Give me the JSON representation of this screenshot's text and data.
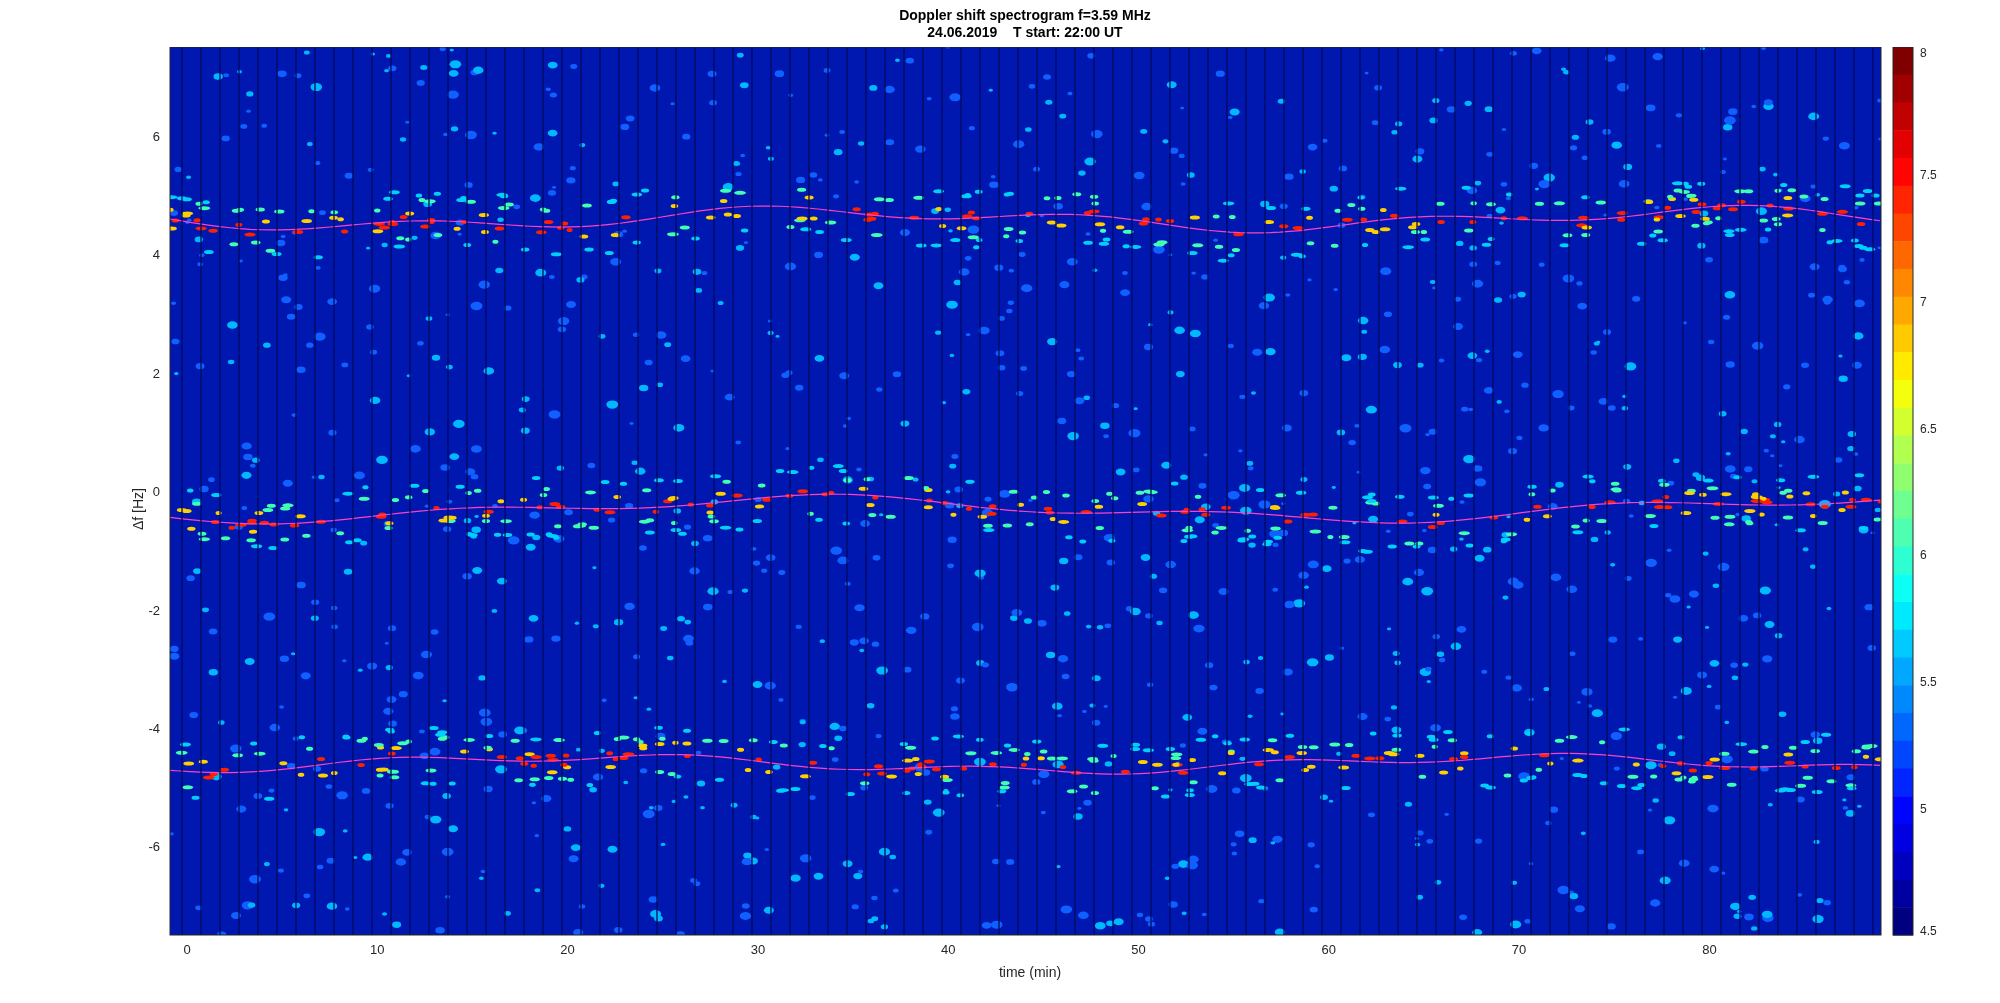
{
  "title": {
    "lines": [
      "Doppler shift spectrogram f=3.59 MHz",
      "24.06.2019    T start: 22:00 UT"
    ]
  },
  "plot": {
    "xlabel": "time (min)",
    "ylabel": "Δf [Hz]",
    "xticks": [
      "0",
      "10",
      "20",
      "30",
      "40",
      "50",
      "60",
      "70",
      "80"
    ],
    "yticks": [
      "6",
      "4",
      "2",
      "0",
      "-2",
      "-4",
      "-6"
    ]
  },
  "colorbar": {
    "ticks": [
      "8",
      "7.5",
      "7",
      "6.5",
      "6",
      "5.5",
      "5",
      "4.5"
    ]
  }
}
